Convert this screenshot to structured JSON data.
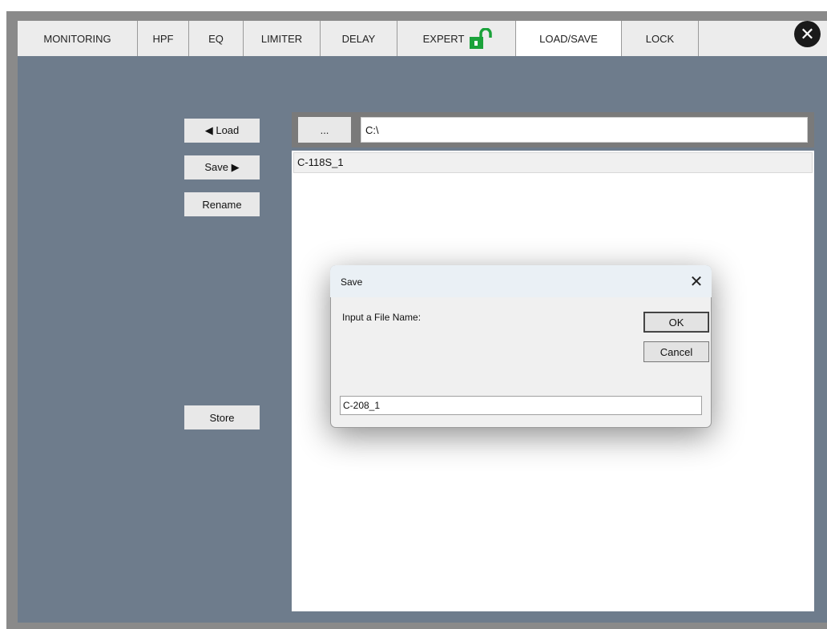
{
  "tabs": [
    {
      "label": "MONITORING"
    },
    {
      "label": "HPF"
    },
    {
      "label": "EQ"
    },
    {
      "label": "LIMITER"
    },
    {
      "label": "DELAY"
    },
    {
      "label": "EXPERT",
      "icon": "unlocked-padlock-icon",
      "icon_color": "#1aa23a"
    },
    {
      "label": "LOAD/SAVE",
      "active": true
    },
    {
      "label": "LOCK"
    }
  ],
  "close_icon": "close-circle-icon",
  "side_buttons": {
    "load": "◀ Load",
    "save": "Save ▶",
    "rename": "Rename",
    "store": "Store"
  },
  "file_panel": {
    "browse_label": "...",
    "path_value": "C:\\",
    "files": [
      "C-118S_1"
    ]
  },
  "dialog": {
    "title": "Save",
    "close_glyph": "✕",
    "prompt": "Input a File Name:",
    "ok_label": "OK",
    "cancel_label": "Cancel",
    "filename_value": "C-208_1"
  },
  "colors": {
    "content_bg": "#6e7c8c",
    "tab_bg": "#ececec",
    "active_tab_bg": "#ffffff",
    "dialog_bg": "#f0f0f0"
  }
}
